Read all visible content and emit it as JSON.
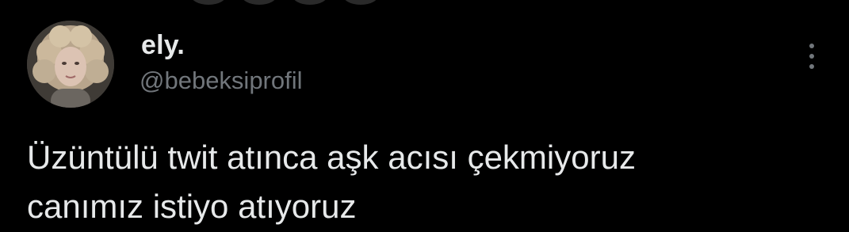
{
  "tweet": {
    "display_name": "ely.",
    "handle": "@bebeksiprofil",
    "text_lines": [
      "Üzüntülü twit atınca aşk acısı çekmiyoruz",
      "canımız istiyo atıyoruz"
    ],
    "more_icon": "more-vertical-icon"
  },
  "colors": {
    "background": "#000000",
    "text_primary": "#e7e9ea",
    "text_secondary": "#71767b"
  }
}
